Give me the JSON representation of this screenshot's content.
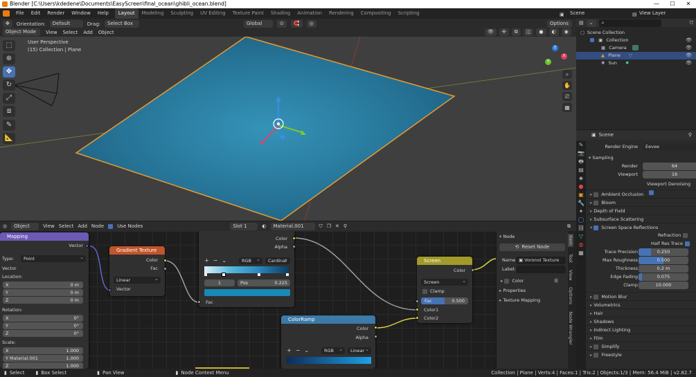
{
  "window": {
    "title": "Blender [C:\\Users\\kdedene\\Documents\\EasyScreen\\final_ocean\\ghibli_ocean.blend]",
    "minimize": "—",
    "maximize": "☐",
    "close": "✕"
  },
  "menu": [
    "File",
    "Edit",
    "Render",
    "Window",
    "Help"
  ],
  "workspaces": [
    "Layout",
    "Modeling",
    "Sculpting",
    "UV Editing",
    "Texture Paint",
    "Shading",
    "Animation",
    "Rendering",
    "Compositing",
    "Scripting"
  ],
  "active_workspace": "Layout",
  "scene_name": "Scene",
  "view_layer": "View Layer",
  "vp_toolbar": {
    "orientation_label": "Orientation:",
    "orientation": "Default",
    "drag_label": "Drag:",
    "drag": "Select Box",
    "transform_orientation": "Global",
    "options": "Options"
  },
  "vp_header": {
    "mode": "Object Mode",
    "view": "View",
    "select": "Select",
    "add": "Add",
    "object": "Object"
  },
  "viewport": {
    "line1": "User Perspective",
    "line2": "(15) Collection | Plane"
  },
  "gizmo": {
    "x": "X",
    "y": "Y",
    "z": "Z"
  },
  "outliner": {
    "root": "Scene Collection",
    "items": [
      {
        "label": "Collection"
      },
      {
        "label": "Camera"
      },
      {
        "label": "Plane"
      },
      {
        "label": "Sun"
      }
    ]
  },
  "props": {
    "scene": "Scene",
    "render_engine_label": "Render Engine",
    "render_engine": "Eevee",
    "sampling": "Sampling",
    "render_label": "Render",
    "render_val": "64",
    "viewport_label": "Viewport",
    "viewport_val": "16",
    "denoise": "Viewport Denoising",
    "panels": [
      "Ambient Occlusion",
      "Bloom",
      "Depth of Field",
      "Subsurface Scattering",
      "Screen Space Reflections"
    ],
    "ssr": [
      {
        "label": "Refraction"
      },
      {
        "label": "Half Res Trace"
      }
    ],
    "ssr_fields": [
      {
        "label": "Trace Precision",
        "value": "0.250",
        "fill": 0.25
      },
      {
        "label": "Max Roughness",
        "value": "0.500",
        "fill": 0.5
      },
      {
        "label": "Thickness",
        "value": "0.2 m",
        "fill": 0
      },
      {
        "label": "Edge Fading",
        "value": "0.075",
        "fill": 0.075
      },
      {
        "label": "Clamp",
        "value": "10.000",
        "fill": 0
      }
    ],
    "panels2": [
      "Motion Blur",
      "Volumetrics",
      "Hair",
      "Shadows",
      "Indirect Lighting",
      "Film",
      "Simplify",
      "Freestyle"
    ]
  },
  "ne_header": {
    "editor": "Object",
    "view": "View",
    "select": "Select",
    "add": "Add",
    "node": "Node",
    "use_nodes": "Use Nodes",
    "slot": "Slot 1",
    "material": "Material.001"
  },
  "nodes": {
    "mapping": {
      "title": "Mapping",
      "vector_out": "Vector",
      "type_label": "Type:",
      "type": "Point",
      "vector": "Vector",
      "location": "Location:",
      "rotation": "Rotation:",
      "scale": "Scale:",
      "loc": [
        {
          "a": "X",
          "v": "0 m"
        },
        {
          "a": "Y",
          "v": "0 m"
        },
        {
          "a": "Z",
          "v": "0 m"
        }
      ],
      "rot": [
        {
          "a": "X",
          "v": "0°"
        },
        {
          "a": "Y",
          "v": "0°"
        },
        {
          "a": "Z",
          "v": "0°"
        }
      ],
      "scl": [
        {
          "a": "X",
          "v": "1.000"
        },
        {
          "a": "Y",
          "v": "1.000"
        },
        {
          "a": "Z",
          "v": "1.000"
        }
      ],
      "material_text": "Material.001"
    },
    "gradient": {
      "title": "Gradient Texture",
      "color": "Color",
      "fac": "Fac",
      "type": "Linear",
      "vector": "Vector"
    },
    "ramp1": {
      "color": "Color",
      "alpha": "Alpha",
      "mode": "RGB",
      "interp": "Cardinal",
      "index": "1",
      "pos_label": "Pos",
      "pos": "0.225",
      "fac": "Fac"
    },
    "ramp2": {
      "title": "ColorRamp",
      "color": "Color",
      "alpha": "Alpha",
      "mode": "RGB",
      "interp": "Linear"
    },
    "screen": {
      "title": "Screen",
      "color": "Color",
      "blend": "Screen",
      "clamp": "Clamp",
      "fac_label": "Fac",
      "fac": "0.500",
      "color1": "Color1",
      "color2": "Color2"
    }
  },
  "npanel": {
    "node_hdr": "Node",
    "reset": "Reset Node",
    "name_label": "Name:",
    "name": "Voronoi Texture",
    "label_label": "Label:",
    "color": "Color",
    "properties": "Properties",
    "texmap": "Texture Mapping"
  },
  "sidetabs": [
    "Item",
    "Tool",
    "View",
    "Options",
    "Node Wrangler"
  ],
  "status": {
    "select": "Select",
    "box": "Box Select",
    "pan": "Pan View",
    "ctx": "Node Context Menu",
    "stats": "Collection | Plane | Verts:4 | Faces:1 | Tris:2 | Objects:1/3 | Mem: 56.4 MiB | v2.82.7"
  }
}
